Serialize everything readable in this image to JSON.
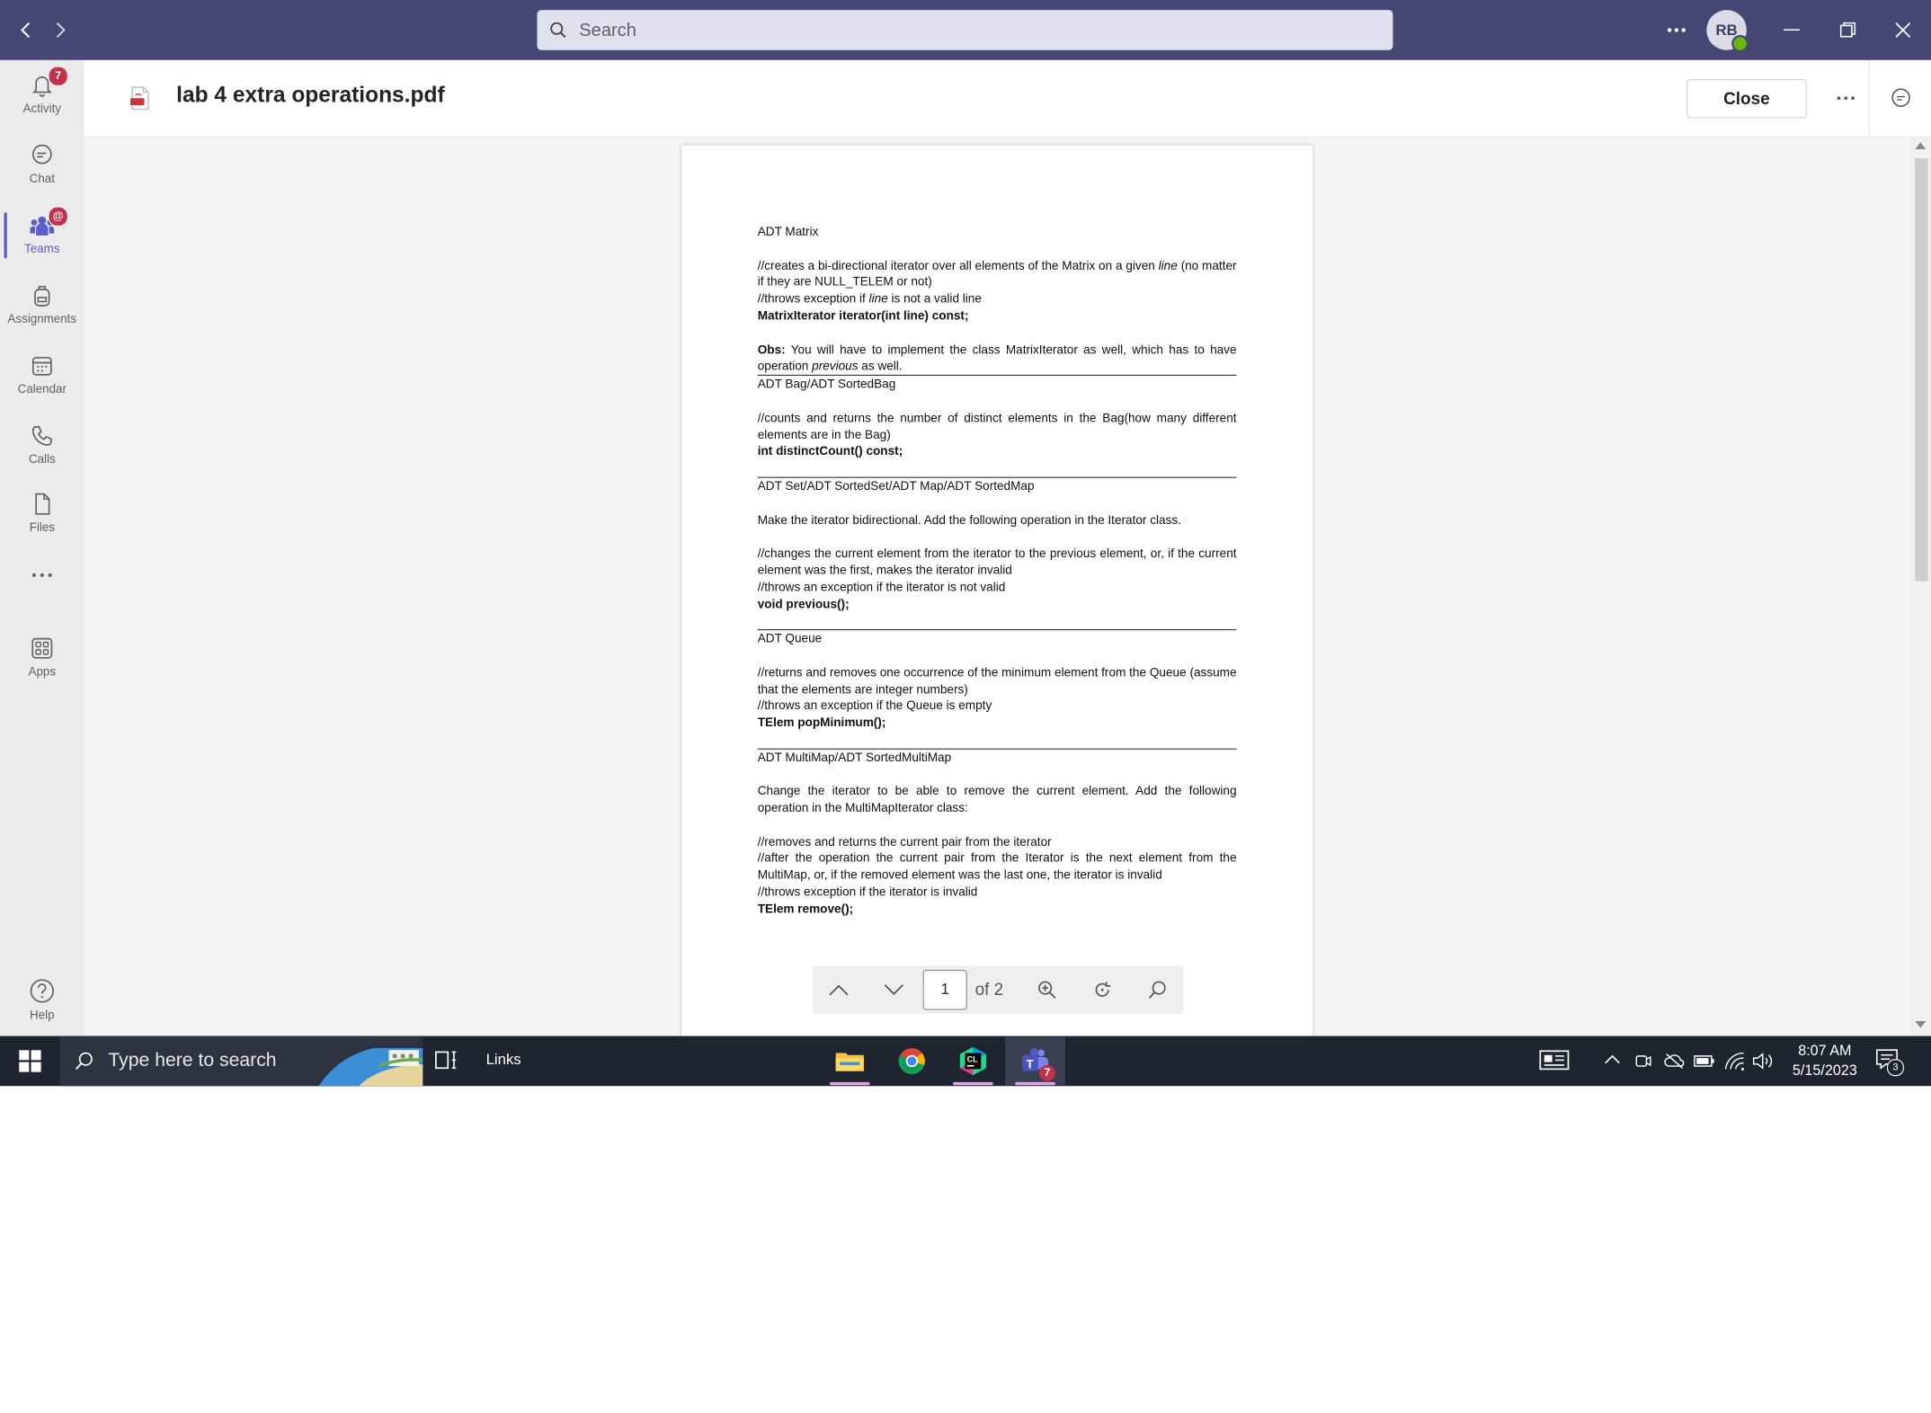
{
  "titlebar": {
    "search_placeholder": "Search",
    "avatar_initials": "RB",
    "accent": "#464775"
  },
  "rail": {
    "items": [
      {
        "label": "Activity",
        "badge": "7",
        "icon": "bell-icon"
      },
      {
        "label": "Chat",
        "icon": "chat-icon"
      },
      {
        "label": "Teams",
        "badge": "@",
        "icon": "teams-icon",
        "active": true
      },
      {
        "label": "Assignments",
        "icon": "backpack-icon"
      },
      {
        "label": "Calendar",
        "icon": "calendar-icon"
      },
      {
        "label": "Calls",
        "icon": "phone-icon"
      },
      {
        "label": "Files",
        "icon": "file-icon"
      },
      {
        "label": "Apps",
        "icon": "apps-icon"
      },
      {
        "label": "Help",
        "icon": "help-icon"
      }
    ]
  },
  "header": {
    "file_name": "lab 4 extra operations.pdf",
    "close_label": "Close"
  },
  "document": {
    "s1_title": "ADT Matrix",
    "s1_l1a": "//creates a bi-directional iterator over all elements of the Matrix on a given ",
    "s1_l1_line": "line",
    "s1_l1b": " (no matter if they are NULL_TELEM or not)",
    "s1_l2a": "//throws exception if ",
    "s1_l2_line": "line",
    "s1_l2b": " is not a valid line",
    "s1_sig": "MatrixIterator iterator(int line) const;",
    "s1_obs_label": "Obs:",
    "s1_obs_a": " You will have to implement the class MatrixIterator as well, which has to have operation ",
    "s1_obs_prev": "previous",
    "s1_obs_b": " as well.",
    "s2_title": "ADT Bag/ADT SortedBag",
    "s2_l1": "//counts and returns the number of distinct elements in the Bag(how many different elements are in the Bag)",
    "s2_sig": "int distinctCount() const;",
    "s3_title": "ADT Set/ADT SortedSet/ADT Map/ADT SortedMap",
    "s3_l1": "Make the iterator bidirectional. Add the following operation in the Iterator class.",
    "s3_l2": "//changes the current element from the iterator to the previous element, or, if the current element was the first, makes the iterator invalid",
    "s3_l3": "//throws an exception if the iterator is not valid",
    "s3_sig": "void previous();",
    "s4_title": "ADT Queue",
    "s4_l1": "//returns and removes one occurrence of the minimum element from the Queue (assume that the elements are integer numbers)",
    "s4_l2": "//throws an exception if the Queue is empty",
    "s4_sig": "TElem popMinimum();",
    "s5_title": "ADT MultiMap/ADT SortedMultiMap",
    "s5_l1": "Change the iterator to be able to remove the current element. Add the following operation in the MultiMapIterator class:",
    "s5_l2": "//removes and returns the current pair from the iterator",
    "s5_l3": "//after the operation the current pair from the Iterator is the next element from the MultiMap, or, if the removed element was the last one, the iterator is invalid",
    "s5_l4": "//throws exception if the iterator is invalid",
    "s5_sig": "TElem remove();"
  },
  "pager": {
    "current_page": "1",
    "of_label": "of 2"
  },
  "taskbar": {
    "search_placeholder": "Type here to search",
    "links_label": "Links",
    "time": "8:07 AM",
    "date": "5/15/2023",
    "notification_count": "3",
    "teams_badge": "7"
  }
}
